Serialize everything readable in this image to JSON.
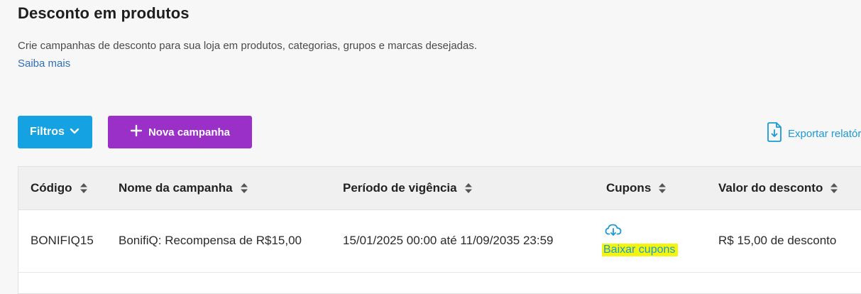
{
  "header": {
    "title": "Desconto em produtos",
    "description": "Crie campanhas de desconto para sua loja em produtos, categorias, grupos e marcas desejadas.",
    "learn_more": "Saiba mais"
  },
  "toolbar": {
    "filters_label": "Filtros",
    "new_campaign_label": "Nova campanha",
    "export_label": "Exportar relatório"
  },
  "table": {
    "columns": [
      "Código",
      "Nome da campanha",
      "Período de vigência",
      "Cupons",
      "Valor do desconto"
    ],
    "rows": [
      {
        "code": "BONIFIQ15",
        "name": "BonifiQ: Recompensa de R$15,00",
        "period": "15/01/2025 00:00 até 11/09/2035 23:59",
        "coupons_link": "Baixar cupons",
        "discount": "R$ 15,00 de desconto"
      }
    ]
  },
  "colors": {
    "filters_button": "#14a2e3",
    "new_campaign_button": "#9b30c9",
    "link": "#2f6fb5",
    "accent": "#1a9ad6",
    "highlight": "#f4f50a"
  }
}
